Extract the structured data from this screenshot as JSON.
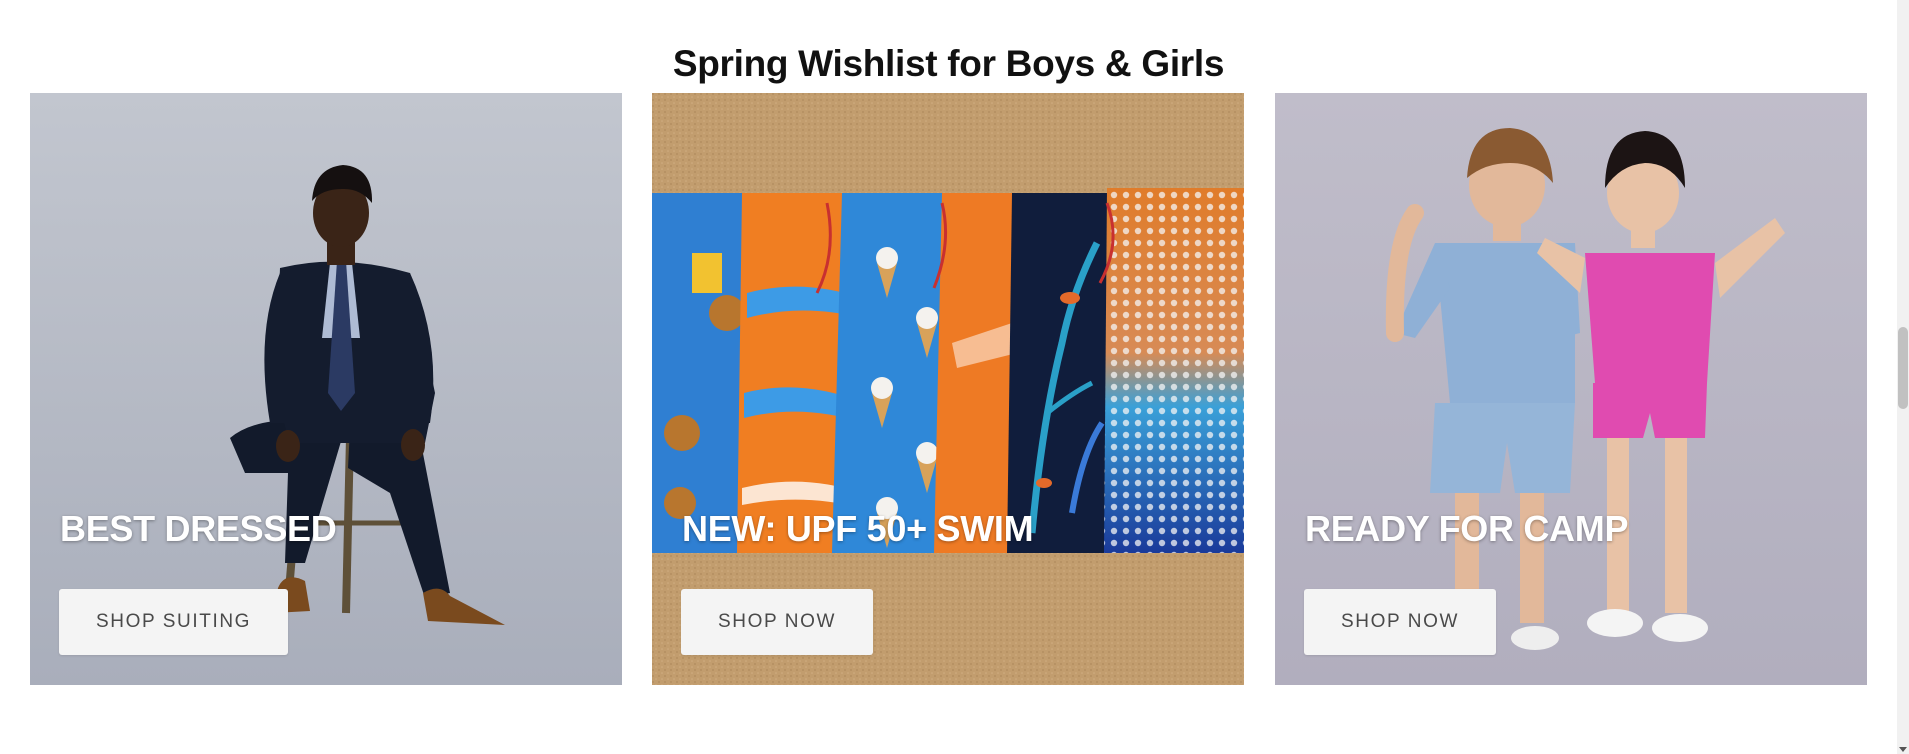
{
  "section": {
    "title": "Spring Wishlist for Boys & Girls"
  },
  "cards": [
    {
      "heading": "BEST DRESSED",
      "button": "SHOP SUITING",
      "image_subject": "boy-in-suit-on-stool",
      "background": "#b8bdc8"
    },
    {
      "heading": "NEW: UPF 50+ SWIM",
      "button": "SHOP NOW",
      "image_subject": "swim-shorts-on-sand",
      "background": "#c29d6e"
    },
    {
      "heading": "READY FOR CAMP",
      "button": "SHOP NOW",
      "image_subject": "kids-in-terry-sets",
      "background": "#b9b6c4"
    }
  ],
  "colors": {
    "button_bg": "#f4f4f4",
    "button_text": "#4a4a4a",
    "heading_text": "#ffffff",
    "title_text": "#111111"
  }
}
